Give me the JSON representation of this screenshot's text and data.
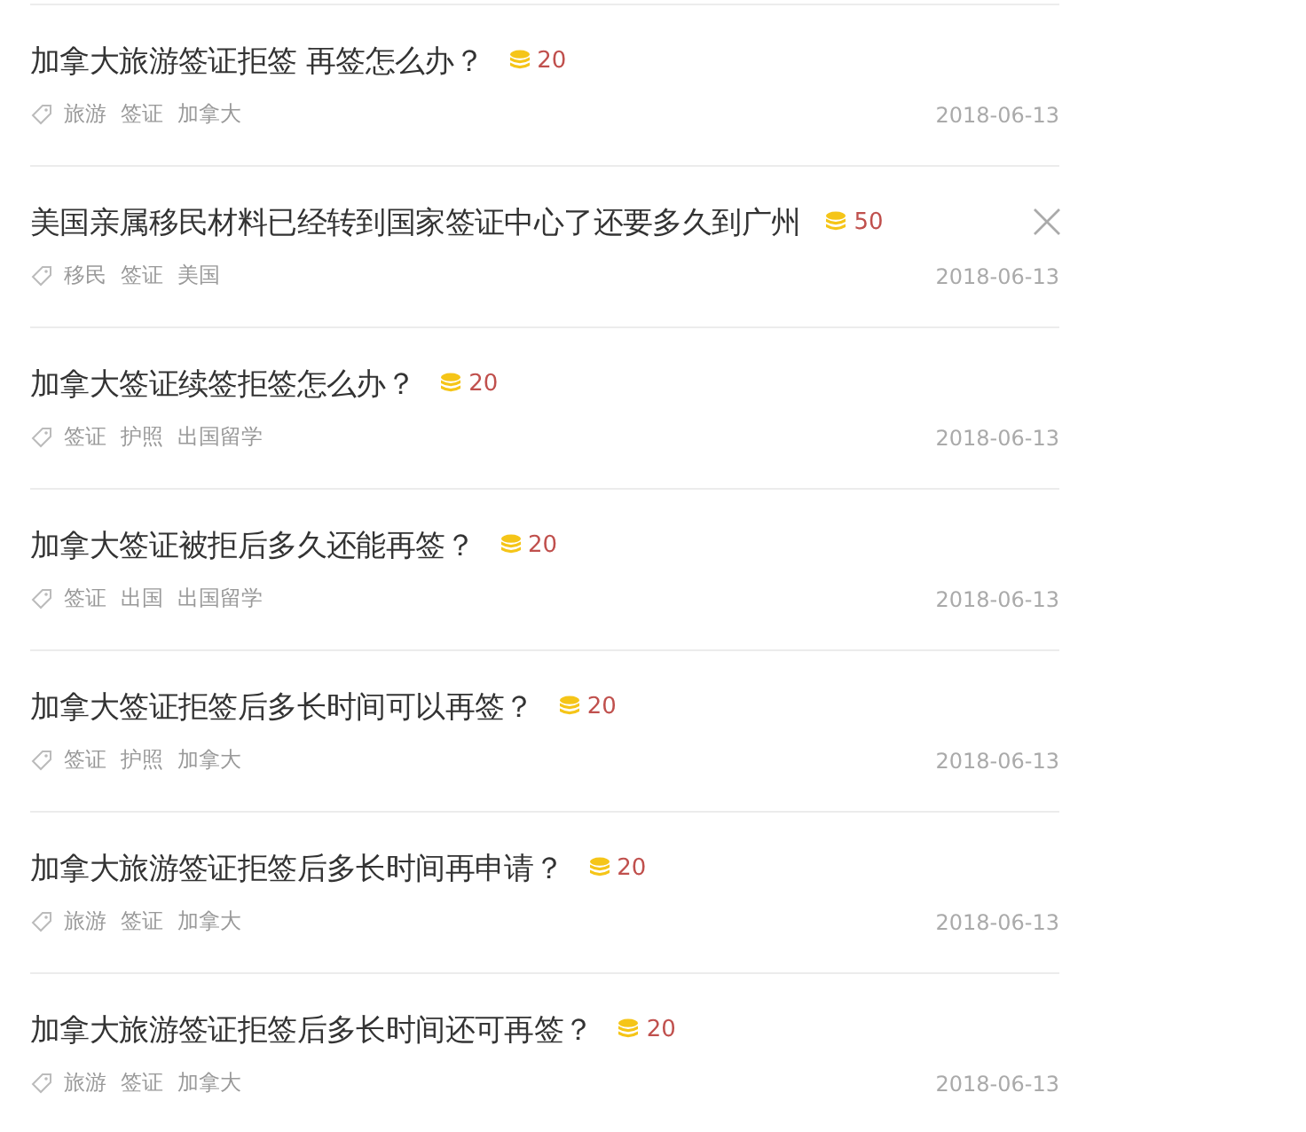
{
  "questions": [
    {
      "title": "加拿大旅游签证拒签 再签怎么办？",
      "reward": "20",
      "tags": [
        "旅游",
        "签证",
        "加拿大"
      ],
      "date": "2018-06-13",
      "closable": false
    },
    {
      "title": "美国亲属移民材料已经转到国家签证中心了还要多久到广州",
      "reward": "50",
      "tags": [
        "移民",
        "签证",
        "美国"
      ],
      "date": "2018-06-13",
      "closable": true
    },
    {
      "title": "加拿大签证续签拒签怎么办？",
      "reward": "20",
      "tags": [
        "签证",
        "护照",
        "出国留学"
      ],
      "date": "2018-06-13",
      "closable": false
    },
    {
      "title": "加拿大签证被拒后多久还能再签？",
      "reward": "20",
      "tags": [
        "签证",
        "出国",
        "出国留学"
      ],
      "date": "2018-06-13",
      "closable": false
    },
    {
      "title": "加拿大签证拒签后多长时间可以再签？",
      "reward": "20",
      "tags": [
        "签证",
        "护照",
        "加拿大"
      ],
      "date": "2018-06-13",
      "closable": false
    },
    {
      "title": "加拿大旅游签证拒签后多长时间再申请？",
      "reward": "20",
      "tags": [
        "旅游",
        "签证",
        "加拿大"
      ],
      "date": "2018-06-13",
      "closable": false
    },
    {
      "title": "加拿大旅游签证拒签后多长时间还可再签？",
      "reward": "20",
      "tags": [
        "旅游",
        "签证",
        "加拿大"
      ],
      "date": "2018-06-13",
      "closable": false
    }
  ]
}
